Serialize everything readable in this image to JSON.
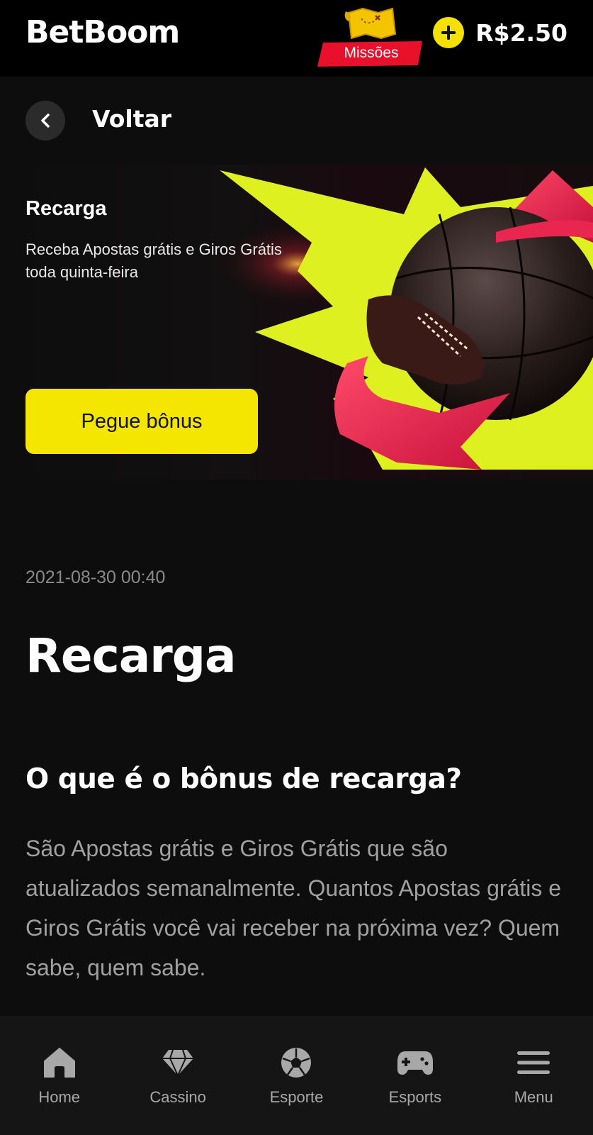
{
  "header": {
    "logo": "BetBoom",
    "missions_label": "Missões",
    "balance": "R$2.50"
  },
  "back": {
    "label": "Voltar"
  },
  "banner": {
    "title": "Recarga",
    "description": "Receba Apostas grátis e Giros Grátis toda quinta-feira",
    "button_label": "Pegue bônus"
  },
  "article": {
    "date": "2021-08-30 00:40",
    "title": "Recarga",
    "section_title": "O que é o bônus de recarga?",
    "section_body": "São Apostas grátis e Giros Grátis que são atualizados semanalmente. Quantos Apostas grátis e Giros Grátis você vai receber na próxima vez? Quem sabe, quem sabe."
  },
  "bottom_nav": {
    "items": [
      {
        "label": "Home",
        "icon": "home-icon"
      },
      {
        "label": "Cassino",
        "icon": "diamond-icon"
      },
      {
        "label": "Esporte",
        "icon": "soccer-ball-icon"
      },
      {
        "label": "Esports",
        "icon": "gamepad-icon"
      },
      {
        "label": "Menu",
        "icon": "menu-icon"
      }
    ]
  },
  "colors": {
    "accent": "#f5e600",
    "banner_red": "#e8264f",
    "background": "#0d0d0d"
  }
}
